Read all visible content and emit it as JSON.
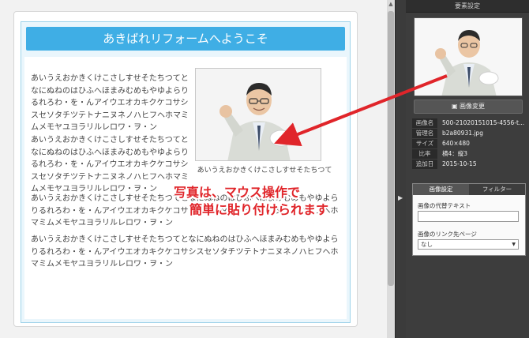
{
  "canvas": {
    "banner_title": "あきばれリフォームへようこそ",
    "paragraph_1": "あいうえおかきくけこさしすせそたちつてとなにぬねのはひふへほまみむめもやゆよらりるれろわ・を・んアイウエオカキクケコサシスセソタチツテトナニヌネノハヒフヘホマミムメモヤユヨラリルレロワ・ヲ・ン",
    "paragraph_2": "あいうえおかきくけこさしすせそたちつてとなにぬねのはひふへほまみむめもやゆよらりるれろわ・を・んアイウエオカキクケコサシスセソタチツテトナニヌネノハヒフヘホマミムメモヤユヨラリルレロワ・ヲ・ン",
    "paragraph_3": "あいうえおかきくけこさしすせそたちつてとなにぬねのはひふへほまみむめもやゆよらりるれろわ・を・んアイウエオカキクケコサシスセソタチツテトナニヌネノハヒフヘホマミムメモヤユヨラリルレロワ・ヲ・ン",
    "paragraph_4": "あいうえおかきくけこさしすせそたちつてとなにぬねのはひふへほまみむめもやゆよらりるれろわ・を・んアイウエオカキクケコサシスセソタチツテトナニヌネノハヒフヘホマミムメモヤユヨラリルレロワ・ヲ・ン",
    "photo_caption": "あいうえおかきくけこさしすせそたちつて"
  },
  "annotation": {
    "line_1": "写真は、マウス操作で",
    "line_2": "簡単に貼り付けられます",
    "color": "#e0252a"
  },
  "panel": {
    "title": "要素設定",
    "change_image_label": "画像変更",
    "change_image_icon": "image-icon",
    "info": [
      {
        "key": "画像名",
        "value": "500-21020151015-4556-t..."
      },
      {
        "key": "管理名",
        "value": "b2a80931.jpg"
      },
      {
        "key": "サイズ",
        "value": "640×480"
      },
      {
        "key": "比率",
        "value": "横4：縦3"
      },
      {
        "key": "追加日",
        "value": "2015-10-15"
      }
    ],
    "tabs": [
      {
        "label": "画像設定",
        "active": true
      },
      {
        "label": "フィルター",
        "active": false
      }
    ],
    "alt_text_label": "画像の代替テキスト",
    "alt_text_value": "",
    "link_label": "画像のリンク先ページ",
    "link_value": "なし"
  },
  "colors": {
    "banner": "#3faee5",
    "panel_bg": "#3d3d3d",
    "accent_red": "#e0252a"
  }
}
